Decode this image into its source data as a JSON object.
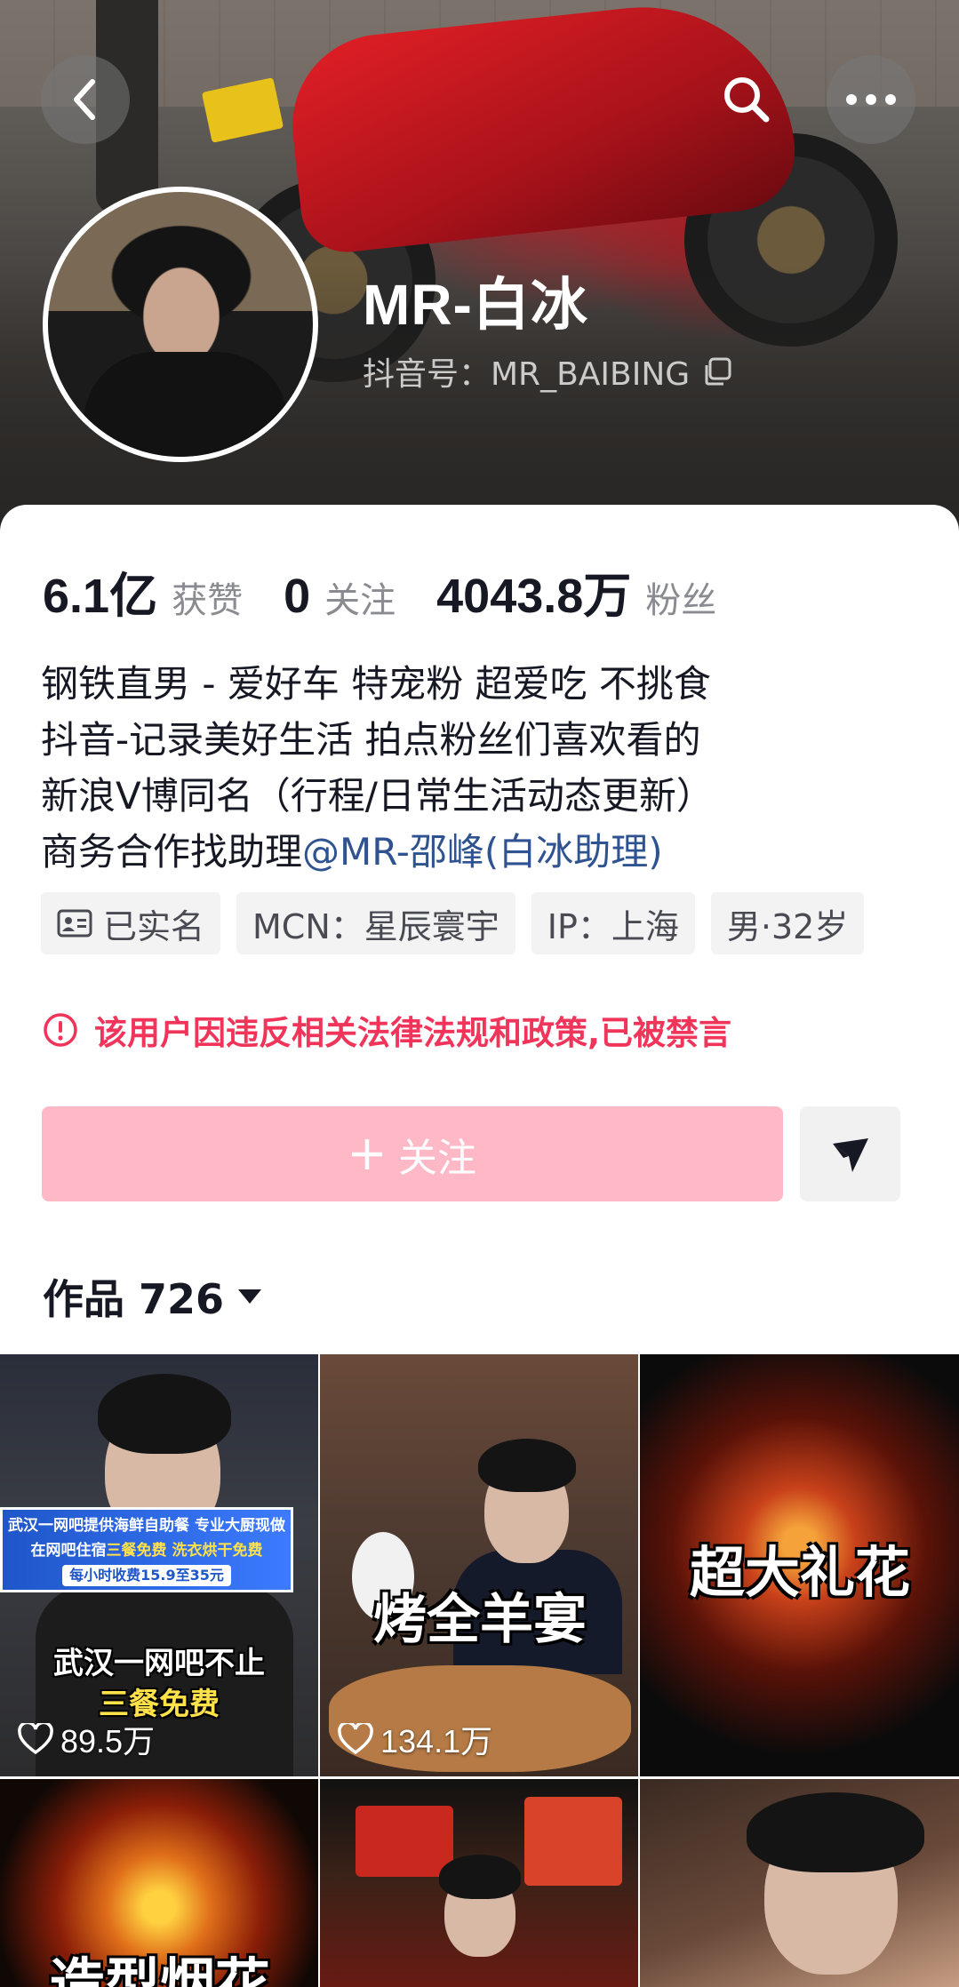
{
  "profile": {
    "username": "MR-白冰",
    "douyin_id": "抖音号：MR_BAIBING",
    "stats": [
      {
        "value": "6.1亿",
        "label": "获赞"
      },
      {
        "value": "0",
        "label": "关注"
      },
      {
        "value": "4043.8万",
        "label": "粉丝"
      }
    ],
    "bio": {
      "line1": "钢铁直男 - 爱好车 特宠粉 超爱吃 不挑食",
      "line2": "抖音-记录美好生活 拍点粉丝们喜欢看的",
      "line3": "新浪V博同名（行程/日常生活动态更新）",
      "line4_prefix": "商务合作找助理",
      "line4_mention": "@MR-邵峰(白冰助理)"
    },
    "tags": {
      "verified": "已实名",
      "mcn": "MCN：星辰寰宇",
      "ip": "IP：上海",
      "gender_age": "男·32岁"
    },
    "warning": "该用户因违反相关法律法规和政策,已被禁言",
    "follow_label": "关注",
    "works_label": "作品 726"
  },
  "videos": [
    {
      "banner_line1": "武汉一网吧提供海鲜自助餐 专业大厨现做",
      "banner_line2_a": "在网吧住宿",
      "banner_line2_b": "三餐免费",
      "banner_line2_c": "洗衣烘干免费",
      "banner_line3": "每小时收费15.9至35元",
      "caption_line1": "武汉一网吧不止",
      "caption_line2": "三餐免费",
      "likes": "89.5万"
    },
    {
      "caption": "烤全羊宴",
      "likes": "134.1万"
    },
    {
      "caption": "超大礼花"
    },
    {
      "caption": "造型烟花"
    },
    {
      "caption": ""
    },
    {
      "caption": ""
    }
  ],
  "colors": {
    "follow_bg": "#feb8c6",
    "warning": "#f0345a",
    "mention": "#2f5391"
  },
  "icons": [
    "back-arrow-icon",
    "search-icon",
    "more-icon",
    "copy-icon",
    "id-card-icon",
    "alert-icon",
    "plus-icon",
    "share-send-icon",
    "dropdown-triangle-icon",
    "heart-icon"
  ]
}
